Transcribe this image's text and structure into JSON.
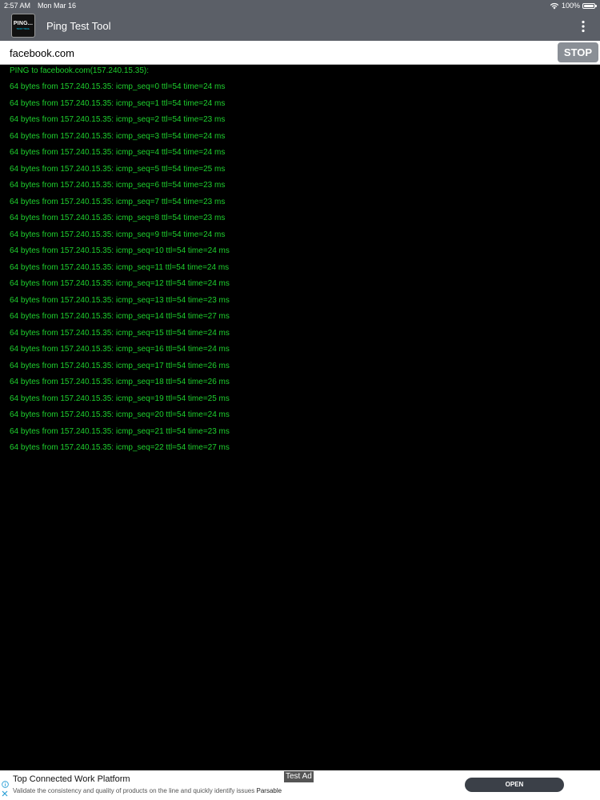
{
  "status_bar": {
    "time": "2:57 AM",
    "date": "Mon Mar 16",
    "battery": "100%"
  },
  "header": {
    "title": "Ping Test Tool",
    "logo_text": "PING...",
    "logo_subtext": "TEST TOOL"
  },
  "input": {
    "host": "facebook.com"
  },
  "controls": {
    "stop_label": "STOP"
  },
  "output": {
    "lines": [
      "PING to facebook.com(157.240.15.35):",
      "64 bytes from 157.240.15.35: icmp_seq=0 ttl=54 time=24 ms",
      "64 bytes from 157.240.15.35: icmp_seq=1 ttl=54 time=24 ms",
      "64 bytes from 157.240.15.35: icmp_seq=2 ttl=54 time=23 ms",
      "64 bytes from 157.240.15.35: icmp_seq=3 ttl=54 time=24 ms",
      "64 bytes from 157.240.15.35: icmp_seq=4 ttl=54 time=24 ms",
      "64 bytes from 157.240.15.35: icmp_seq=5 ttl=54 time=25 ms",
      "64 bytes from 157.240.15.35: icmp_seq=6 ttl=54 time=23 ms",
      "64 bytes from 157.240.15.35: icmp_seq=7 ttl=54 time=23 ms",
      "64 bytes from 157.240.15.35: icmp_seq=8 ttl=54 time=23 ms",
      "64 bytes from 157.240.15.35: icmp_seq=9 ttl=54 time=24 ms",
      "64 bytes from 157.240.15.35: icmp_seq=10 ttl=54 time=24 ms",
      "64 bytes from 157.240.15.35: icmp_seq=11 ttl=54 time=24 ms",
      "64 bytes from 157.240.15.35: icmp_seq=12 ttl=54 time=24 ms",
      "64 bytes from 157.240.15.35: icmp_seq=13 ttl=54 time=23 ms",
      "64 bytes from 157.240.15.35: icmp_seq=14 ttl=54 time=27 ms",
      "64 bytes from 157.240.15.35: icmp_seq=15 ttl=54 time=24 ms",
      "64 bytes from 157.240.15.35: icmp_seq=16 ttl=54 time=24 ms",
      "64 bytes from 157.240.15.35: icmp_seq=17 ttl=54 time=26 ms",
      "64 bytes from 157.240.15.35: icmp_seq=18 ttl=54 time=26 ms",
      "64 bytes from 157.240.15.35: icmp_seq=19 ttl=54 time=25 ms",
      "64 bytes from 157.240.15.35: icmp_seq=20 ttl=54 time=24 ms",
      "64 bytes from 157.240.15.35: icmp_seq=21 ttl=54 time=23 ms",
      "64 bytes from 157.240.15.35: icmp_seq=22 ttl=54 time=27 ms"
    ]
  },
  "ad": {
    "title": "Top Connected Work Platform",
    "description": "Validate the consistency and quality of products on the line and quickly identify issues",
    "brand": "Parsable",
    "test_label": "Test Ad",
    "open_label": "OPEN"
  },
  "colors": {
    "header_bg": "#5b5f67",
    "console_bg": "#000000",
    "console_text": "#1ed12e",
    "stop_button": "#8a8f96",
    "ad_button": "#3b4048"
  },
  "icons": {
    "wifi": "wifi-icon",
    "battery": "battery-icon",
    "more": "more-vertical-icon",
    "ad_info": "info-icon",
    "ad_close": "close-icon"
  }
}
